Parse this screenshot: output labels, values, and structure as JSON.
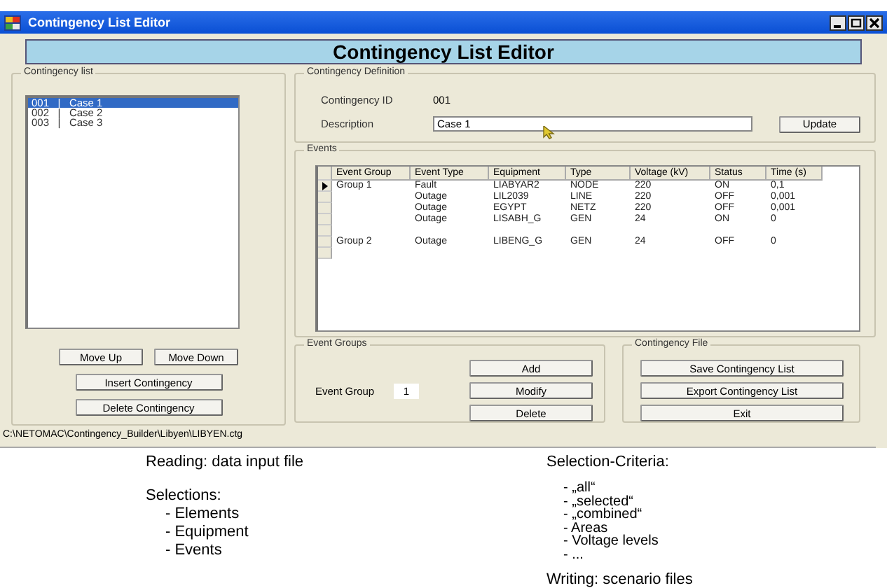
{
  "window": {
    "title": "Contingency List Editor"
  },
  "header": "Contingency List Editor",
  "contingency_list": {
    "title": "Contingency list",
    "items": [
      {
        "label": "001   |   Case 1",
        "selected": true
      },
      {
        "label": "002   |   Case 2",
        "selected": false
      },
      {
        "label": "003   |   Case 3",
        "selected": false
      }
    ],
    "buttons": [
      "Move Up",
      "Move Down",
      "Insert Contingency",
      "Delete Contingency"
    ]
  },
  "definition": {
    "title": "Contingency Definition",
    "id_label": "Contingency ID",
    "id_value": "001",
    "description_label": "Description",
    "description_value": "Case 1",
    "update_button": "Update"
  },
  "events": {
    "title": "Events",
    "columns": [
      "Event Group",
      "Event Type",
      "Equipment",
      "Type",
      "Voltage (kV)",
      "Status",
      "Time (s)"
    ],
    "rows": [
      {
        "kind": "data",
        "current": true,
        "cells": [
          "Group 1",
          "Fault",
          "LIABYAR2",
          "NODE",
          "220",
          "ON",
          "0,1"
        ]
      },
      {
        "kind": "data",
        "current": false,
        "cells": [
          null,
          "Outage",
          "LIL2039",
          "LINE",
          "220",
          "OFF",
          "0,001"
        ]
      },
      {
        "kind": "data",
        "current": false,
        "cells": [
          null,
          "Outage",
          "EGYPT",
          "NETZ",
          "220",
          "OFF",
          "0,001"
        ]
      },
      {
        "kind": "data",
        "current": false,
        "cells": [
          null,
          "Outage",
          "LISABH_G",
          "GEN",
          "24",
          "ON",
          "0"
        ]
      },
      {
        "kind": "blank",
        "current": false
      },
      {
        "kind": "data",
        "current": false,
        "cells": [
          "Group 2",
          "Outage",
          "LIBENG_G",
          "GEN",
          "24",
          "OFF",
          "0"
        ]
      },
      {
        "kind": "blank",
        "current": false
      }
    ]
  },
  "event_groups": {
    "title": "Event Groups",
    "label": "Event Group",
    "value": "1",
    "buttons": [
      "Add",
      "Modify",
      "Delete"
    ]
  },
  "contingency_file": {
    "title": "Contingency File",
    "buttons": [
      "Save Contingency List",
      "Export Contingency List",
      "Exit"
    ]
  },
  "status_bar": "C:\\NETOMAC\\Contingency_Builder\\Libyen\\LIBYEN.ctg",
  "notes": {
    "left": [
      {
        "kind": "heading",
        "text": "Reading: data input file"
      },
      {
        "kind": "gap"
      },
      {
        "kind": "heading",
        "text": "Selections:"
      },
      {
        "kind": "bullet",
        "text": "- Elements"
      },
      {
        "kind": "bullet",
        "text": "- Equipment"
      },
      {
        "kind": "bullet",
        "text": "- Events"
      }
    ],
    "right": [
      {
        "kind": "heading",
        "text": "Selection-Criteria:"
      },
      {
        "kind": "gap"
      },
      {
        "kind": "bullet",
        "text": "- „all“"
      },
      {
        "kind": "bullet",
        "text": "- „selected“"
      },
      {
        "kind": "bullet",
        "text": "- „combined“"
      },
      {
        "kind": "bullet",
        "text": "- Areas"
      },
      {
        "kind": "bullet",
        "text": "- Voltage levels"
      },
      {
        "kind": "bullet",
        "text": "- ..."
      },
      {
        "kind": "gap"
      },
      {
        "kind": "heading",
        "text": "Writing: scenario files"
      }
    ]
  }
}
